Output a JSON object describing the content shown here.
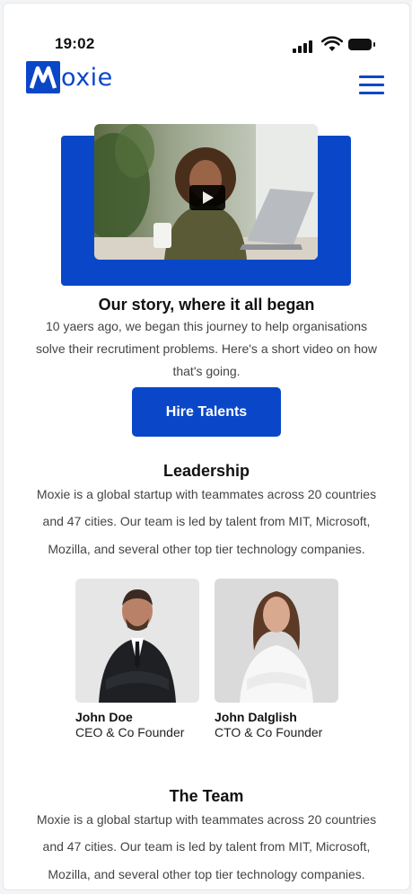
{
  "status_bar": {
    "time": "19:02"
  },
  "header": {
    "logo_text": "oxie",
    "logo_letter": "M"
  },
  "story": {
    "title": "Our story, where it all began",
    "lines": [
      "10 yaers ago, we began this journey to help organisations",
      "solve their recrutiment problems. Here's a short video on how",
      "that's going."
    ],
    "button_label": "Hire Talents"
  },
  "leadership": {
    "title": "Leadership",
    "lines": [
      "Moxie is a global startup with teammates across 20 countries",
      "and 47 cities. Our team is led by talent from MIT, Microsoft,",
      "Mozilla, and several other top tier technology companies."
    ],
    "people": [
      {
        "name": "John Doe",
        "role": "CEO & Co Founder"
      },
      {
        "name": "John Dalglish",
        "role": "CTO & Co Founder"
      }
    ]
  },
  "team": {
    "title": "The Team",
    "lines": [
      "Moxie is a global startup with teammates across 20 countries",
      "and 47 cities. Our team is led by talent from MIT, Microsoft,",
      "Mozilla, and several other top tier technology companies."
    ]
  },
  "colors": {
    "brand": "#0a47c8"
  }
}
